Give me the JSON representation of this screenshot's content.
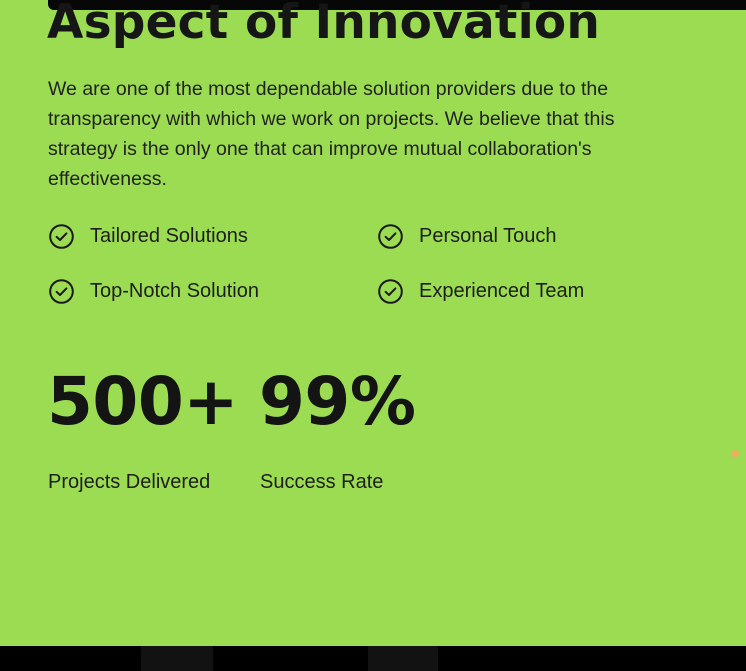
{
  "colors": {
    "background": "#9bdc52",
    "text": "#1c1c1c",
    "accent_dot": "#e8b15a",
    "bars": "#000000"
  },
  "heading": "Aspect of Innovation",
  "intro": "We are one of the most dependable solution providers due to the transparency with which we work on projects. We believe that this strategy is the only one that can improve mutual collaboration's effectiveness.",
  "features": [
    {
      "icon": "check-circle-icon",
      "label": "Tailored Solutions"
    },
    {
      "icon": "check-circle-icon",
      "label": "Personal Touch"
    },
    {
      "icon": "check-circle-icon",
      "label": "Top-Notch Solution"
    },
    {
      "icon": "check-circle-icon",
      "label": "Experienced Team"
    }
  ],
  "stats": [
    {
      "value": "500+",
      "label": "Projects Delivered"
    },
    {
      "value": "99%",
      "label": "Success Rate"
    }
  ]
}
